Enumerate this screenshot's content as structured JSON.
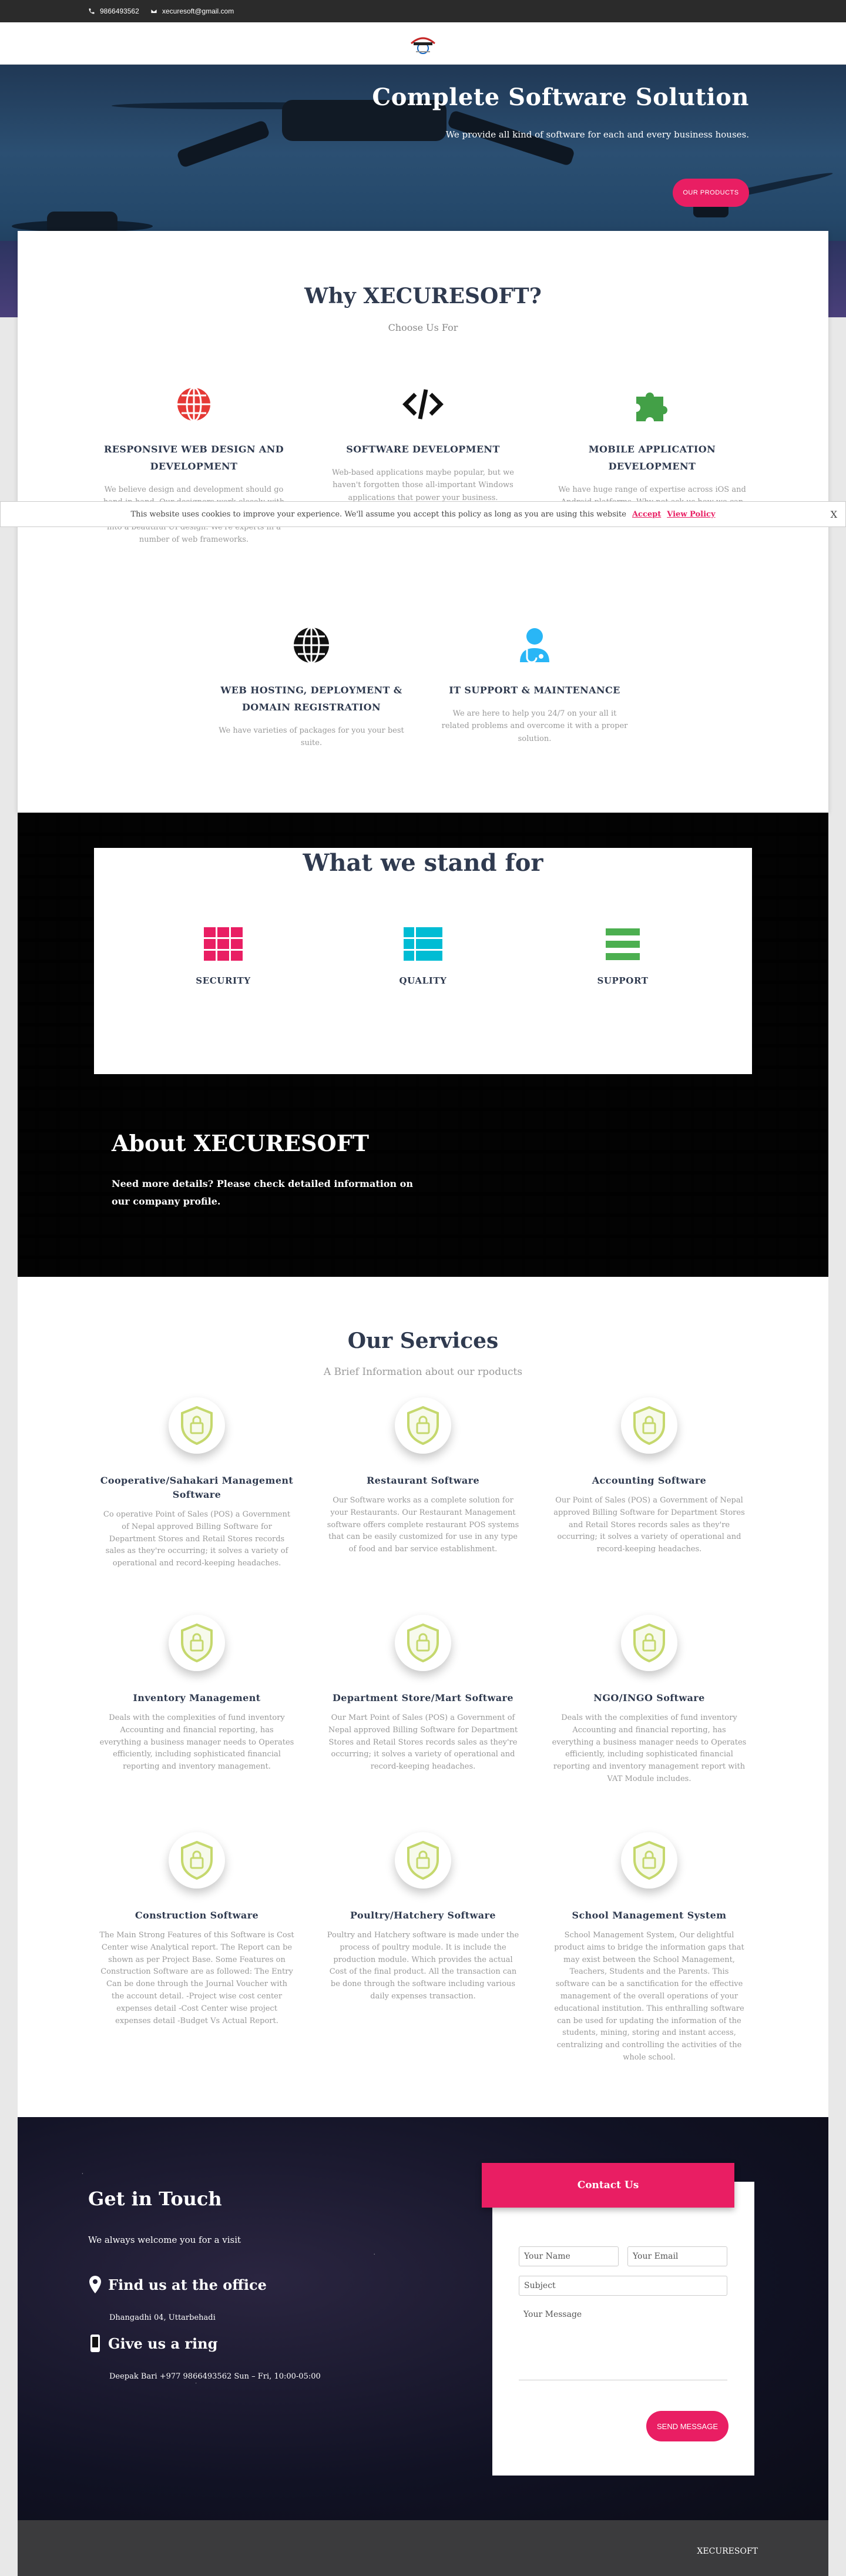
{
  "topbar": {
    "phone": "9866493562",
    "email": "xecuresoft@gmail.com"
  },
  "hero": {
    "title": "Complete Software Solution",
    "subtitle": "We provide all kind of software for each and every business houses.",
    "button": "OUR PRODUCTS"
  },
  "why": {
    "title": "Why XECURESOFT?",
    "subtitle": "Choose Us For",
    "features": [
      {
        "title": "RESPONSIVE WEB DESIGN AND DEVELOPMENT",
        "text": "We believe design and development should go hand-in-hand. Our designers work closely with you to understand your idea before turning it into a beautiful UI design. We're experts in a number of web frameworks.",
        "icon": "globe-red-icon"
      },
      {
        "title": "SOFTWARE DEVELOPMENT",
        "text": "Web-based applications maybe popular, but we haven't forgotten those all-important Windows applications that power your business.",
        "icon": "code-icon"
      },
      {
        "title": "MOBILE APPLICATION DEVELOPMENT",
        "text": "We have huge range of expertise across iOS and Android platforms. Why not ask us how we can turn your idea into reality?",
        "icon": "puzzle-icon"
      },
      {
        "title": "WEB HOSTING, DEPLOYMENT & DOMAIN REGISTRATION",
        "text": "We have varieties of packages for you your best suite.",
        "icon": "globe-black-icon"
      },
      {
        "title": "IT SUPPORT & MAINTENANCE",
        "text": "We are here to help you 24/7 on your all it related problems and overcome it with a proper solution.",
        "icon": "support-icon"
      }
    ]
  },
  "cookie": {
    "text": "This website uses cookies to improve your experience. We'll assume you accept this policy as long as you are using this website",
    "accept": "Accept",
    "policy": "View Policy",
    "close": "X"
  },
  "stand": {
    "title": "What we stand for",
    "items": [
      {
        "label": "SECURITY",
        "color": "#e91e63"
      },
      {
        "label": "QUALITY",
        "color": "#00bcd4"
      },
      {
        "label": "SUPPORT",
        "color": "#4caf50"
      }
    ]
  },
  "about": {
    "title": "About XECURESOFT",
    "text": "Need more details? Please check  detailed information on our company profile."
  },
  "services": {
    "title": "Our Services",
    "subtitle": "A Brief Information about our rpoducts",
    "items": [
      {
        "title": "Cooperative/Sahakari Management Software",
        "text": "Co operative Point of Sales (POS) a Government of Nepal approved Billing Software for Department Stores and Retail Stores records sales as they're occurring; it solves a variety of operational and record-keeping headaches."
      },
      {
        "title": "Restaurant Software",
        "text": "Our Software works as a complete solution for your Restaurants. Our Restaurant Management software offers complete restaurant POS systems that can be easily customized for use in any type of food and bar service establishment."
      },
      {
        "title": "Accounting Software",
        "text": "Our Point of Sales (POS) a Government of Nepal approved Billing Software for Department Stores and Retail Stores records sales as they're occurring; it solves a variety of operational and record-keeping headaches."
      },
      {
        "title": "Inventory Management",
        "text": "Deals with the complexities of fund inventory Accounting and financial reporting, has everything a business manager needs to Operates efficiently, including sophisticated financial reporting and inventory management."
      },
      {
        "title": "Department Store/Mart Software",
        "text": "Our Mart Point of Sales (POS) a Government of Nepal approved Billing Software for Department Stores and Retail Stores records sales as they're occurring; it solves a variety of operational and record-keeping headaches."
      },
      {
        "title": "NGO/INGO Software",
        "text": "Deals with the complexities of fund inventory Accounting and financial reporting, has everything a business manager needs to Operates efficiently, including sophisticated financial reporting and inventory management report with VAT Module includes."
      },
      {
        "title": "Construction Software",
        "text": "The Main Strong Features of this Software is Cost Center wise Analytical report. The Report can be shown as per Project Base. Some Features on Construction Software are as followed: The Entry Can be done through the Journal Voucher with the account detail. -Project wise cost center expenses detail -Cost Center wise project expenses detail -Budget Vs Actual Report."
      },
      {
        "title": "Poultry/Hatchery Software",
        "text": "Poultry and Hatchery software is made under the process of poultry module. It is include the production module. Which provides the actual Cost of the final product. All the transaction can be done through the software including various daily expenses transaction."
      },
      {
        "title": "School Management System",
        "text": "School Management System, Our delightful product aims to bridge the information gaps that may exist between the School Management, Teachers, Students and the Parents. This software can be a sanctification for the effective management of the overall operations of your educational institution. This enthralling software can be used for updating the information of the students, mining, storing and instant access, centralizing and controlling the activities of the whole school."
      }
    ]
  },
  "contact": {
    "title": "Get in Touch",
    "welcome": "We always welcome you for a visit",
    "office_title": "Find us at the office",
    "office_addr": "Dhangadhi 04, Uttarbehadi",
    "ring_title": "Give us a ring",
    "ring_text": "Deepak Bari +977 9866493562 Sun – Fri, 10:00-05:00",
    "form": {
      "header": "Contact Us",
      "name": "Your Name",
      "email": "Your Email",
      "subject": "Subject",
      "message": "Your Message",
      "send": "SEND MESSAGE"
    }
  },
  "footer": {
    "brand": "XECURESOFT"
  }
}
